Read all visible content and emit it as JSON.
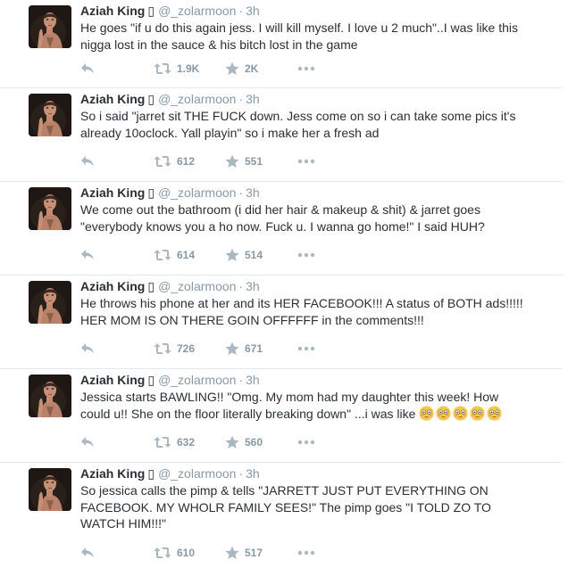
{
  "colors": {
    "text": "#292f33",
    "muted": "#8899a6",
    "icon": "#aab8c2",
    "border": "#e1e8ed"
  },
  "icons": {
    "reply": "reply-icon",
    "retweet": "retweet-icon",
    "favorite": "star-icon",
    "more": "more-dots-icon"
  },
  "tweets": [
    {
      "fullname": "Aziah King",
      "badge": "▯",
      "screen_name": "@_zolarmoon",
      "dot": "·",
      "time": "3h",
      "text": "He goes \"if u do this again jess. I will kill myself. I love u 2 much\"..I was like this nigga lost in the sauce & his bitch lost in the game",
      "retweets": "1.9K",
      "favorites": "2K"
    },
    {
      "fullname": "Aziah King",
      "badge": "▯",
      "screen_name": "@_zolarmoon",
      "dot": "·",
      "time": "3h",
      "text": "So i said \"jarret sit THE FUCK down. Jess come on so i can take some pics it's already 10oclock. Yall playin\" so i make her a fresh ad",
      "retweets": "612",
      "favorites": "551"
    },
    {
      "fullname": "Aziah King",
      "badge": "▯",
      "screen_name": "@_zolarmoon",
      "dot": "·",
      "time": "3h",
      "text": "We come out the bathroom (i did her hair & makeup & shit) & jarret goes \"everybody knows you a ho now. Fuck u. I wanna go home!\" I said HUH?",
      "retweets": "614",
      "favorites": "514"
    },
    {
      "fullname": "Aziah King",
      "badge": "▯",
      "screen_name": "@_zolarmoon",
      "dot": "·",
      "time": "3h",
      "text": "He throws his phone at her and its HER FACEBOOK!!! A status of BOTH ads!!!!! HER MOM IS ON THERE GOIN OFFFFFF in the comments!!!",
      "retweets": "726",
      "favorites": "671"
    },
    {
      "fullname": "Aziah King",
      "badge": "▯",
      "screen_name": "@_zolarmoon",
      "dot": "·",
      "time": "3h",
      "text": "Jessica starts BAWLING!! \"Omg. My mom had my daughter this week! How could u!! She on the floor literally breaking down\" ...i was like",
      "emoji": "flushed-face",
      "emoji_count": 5,
      "retweets": "632",
      "favorites": "560"
    },
    {
      "fullname": "Aziah King",
      "badge": "▯",
      "screen_name": "@_zolarmoon",
      "dot": "·",
      "time": "3h",
      "text": "So jessica calls the pimp & tells \"JARRETT JUST PUT EVERYTHING ON FACEBOOK. MY WHOLR FAMILY SEES!\" The pimp goes \"I TOLD ZO TO WATCH HIM!!!\"",
      "retweets": "610",
      "favorites": "517"
    }
  ]
}
